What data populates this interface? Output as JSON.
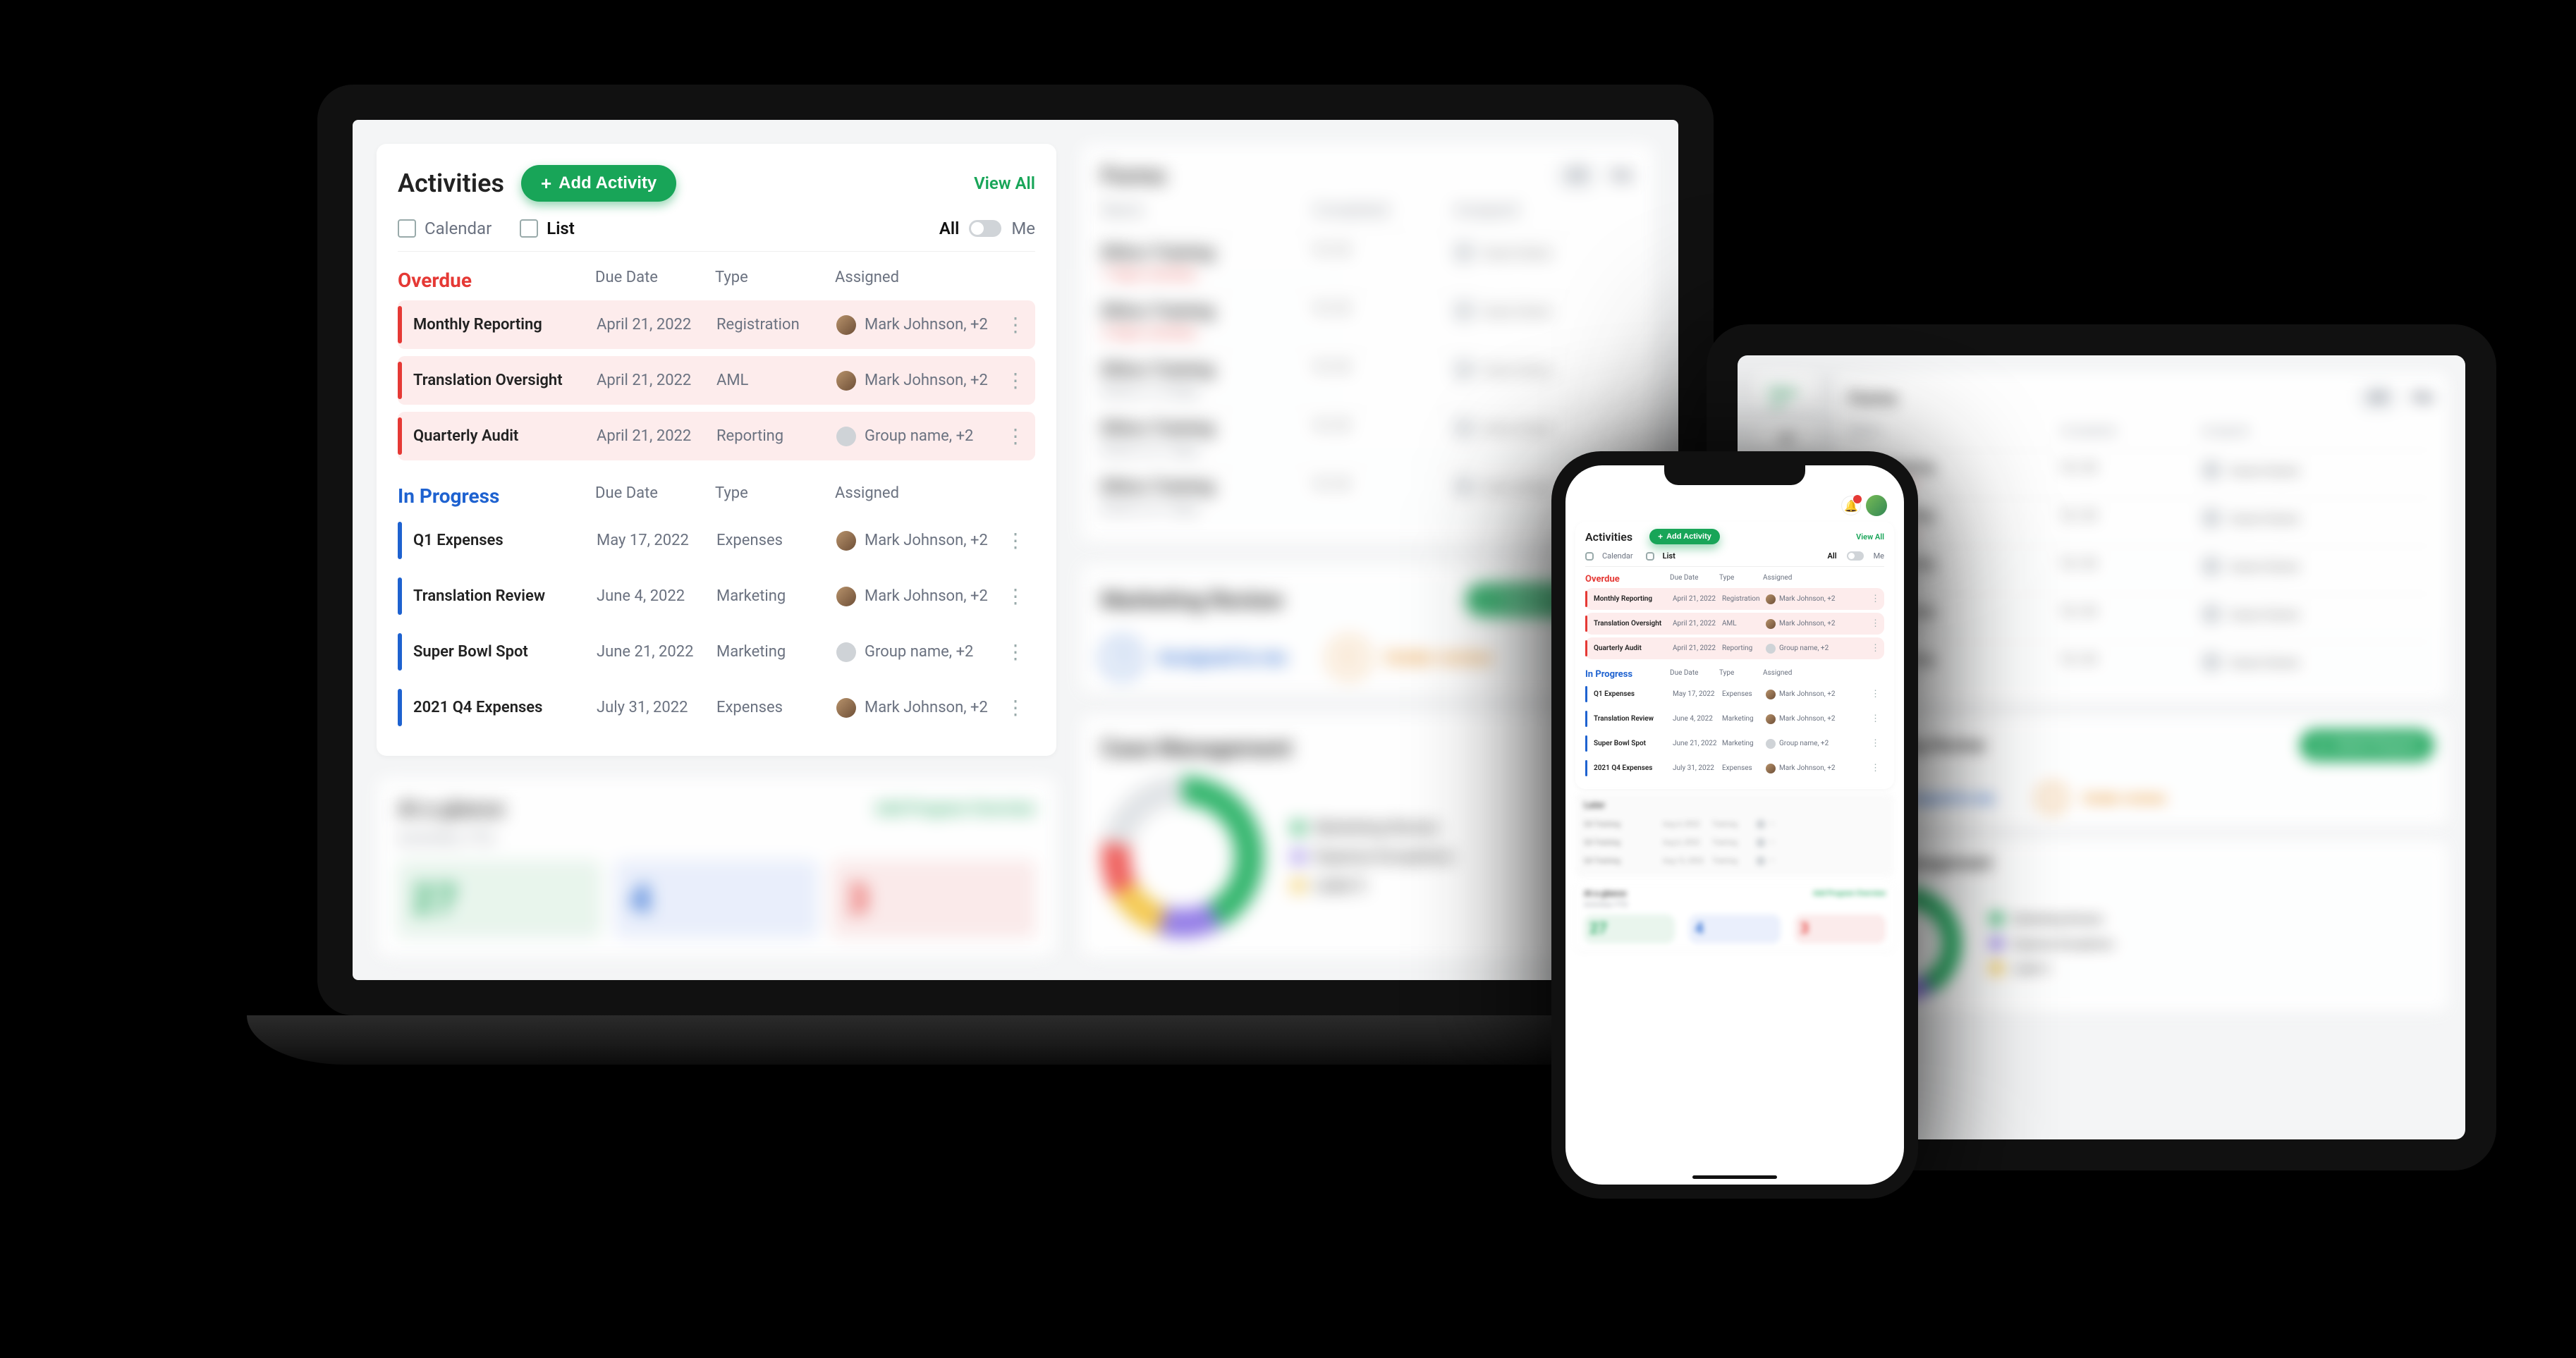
{
  "activities": {
    "title": "Activities",
    "add_button": "Add Activity",
    "view_all": "View All",
    "tab_calendar": "Calendar",
    "tab_list": "List",
    "filter_all": "All",
    "filter_me": "Me",
    "col_due": "Due Date",
    "col_type": "Type",
    "col_assigned": "Assigned",
    "overdue_label": "Overdue",
    "inprogress_label": "In Progress",
    "overdue": [
      {
        "name": "Monthly Reporting",
        "date": "April 21, 2022",
        "type": "Registration",
        "assignee": "Mark Johnson, +2",
        "avatar": "person"
      },
      {
        "name": "Translation Oversight",
        "date": "April 21, 2022",
        "type": "AML",
        "assignee": "Mark Johnson, +2",
        "avatar": "person"
      },
      {
        "name": "Quarterly Audit",
        "date": "April 21, 2022",
        "type": "Reporting",
        "assignee": "Group name, +2",
        "avatar": "grey"
      }
    ],
    "inprogress": [
      {
        "name": "Q1 Expenses",
        "date": "May 17, 2022",
        "type": "Expenses",
        "assignee": "Mark Johnson, +2",
        "avatar": "person"
      },
      {
        "name": "Translation Review",
        "date": "June 4, 2022",
        "type": "Marketing",
        "assignee": "Mark Johnson, +2",
        "avatar": "person"
      },
      {
        "name": "Super Bowl Spot",
        "date": "June 21, 2022",
        "type": "Marketing",
        "assignee": "Group name, +2",
        "avatar": "grey"
      },
      {
        "name": "2021 Q4 Expenses",
        "date": "July 31, 2022",
        "type": "Expenses",
        "assignee": "Mark Johnson, +2",
        "avatar": "person"
      }
    ]
  },
  "forms": {
    "title": "Forms",
    "chip_all": "All",
    "chip_me": "Me",
    "col_name": "Name",
    "col_completed": "Completed",
    "col_assigned": "Assigned",
    "rows": [
      {
        "title": "Ethics Training",
        "sub": "7 days overdue",
        "sub_red": true,
        "stat": "16 / 24",
        "asg": "Susan Greene"
      },
      {
        "title": "Ethics Training",
        "sub": "3 days overdue",
        "sub_red": true,
        "stat": "16 / 24",
        "asg": "Susan Greene"
      },
      {
        "title": "Ethics Training",
        "sub": "Ends in 14 days",
        "sub_red": false,
        "stat": "16 / 24",
        "asg": "Susan Greene"
      },
      {
        "title": "Ethics Training",
        "sub": "Ends in 21 days",
        "sub_red": false,
        "stat": "16 / 24",
        "asg": "Susan Greene"
      },
      {
        "title": "Ethics Training",
        "sub": "Ends in 21 days",
        "sub_red": false,
        "stat": "16 / 24",
        "asg": "Susan Greene"
      }
    ]
  },
  "marketing": {
    "title": "Marketing Review",
    "button": "Submit Request",
    "assigned_n": "3",
    "assigned_l": "Assigned to me",
    "under_n": "6",
    "under_l": "Under review"
  },
  "glance": {
    "title": "At a glance",
    "link": "Add Program Overview",
    "sub": "Activities YTD",
    "boxes": {
      "complete": "27",
      "inprogress": "4",
      "overdue": "3"
    }
  },
  "caseman": {
    "title": "Case Management",
    "legend": [
      "Marketing Review",
      "Expense Exceptions",
      "Label 3"
    ]
  },
  "phone_extra": {
    "later_label": "Later",
    "later_rows": [
      {
        "name": "Q4 Training",
        "date": "Aug 4, 2022",
        "type": "Training"
      },
      {
        "name": "Q4 Training",
        "date": "Aug 6, 2022",
        "type": "Training"
      },
      {
        "name": "Q4 Training",
        "date": "Aug 12, 2022",
        "type": "Training"
      }
    ]
  }
}
